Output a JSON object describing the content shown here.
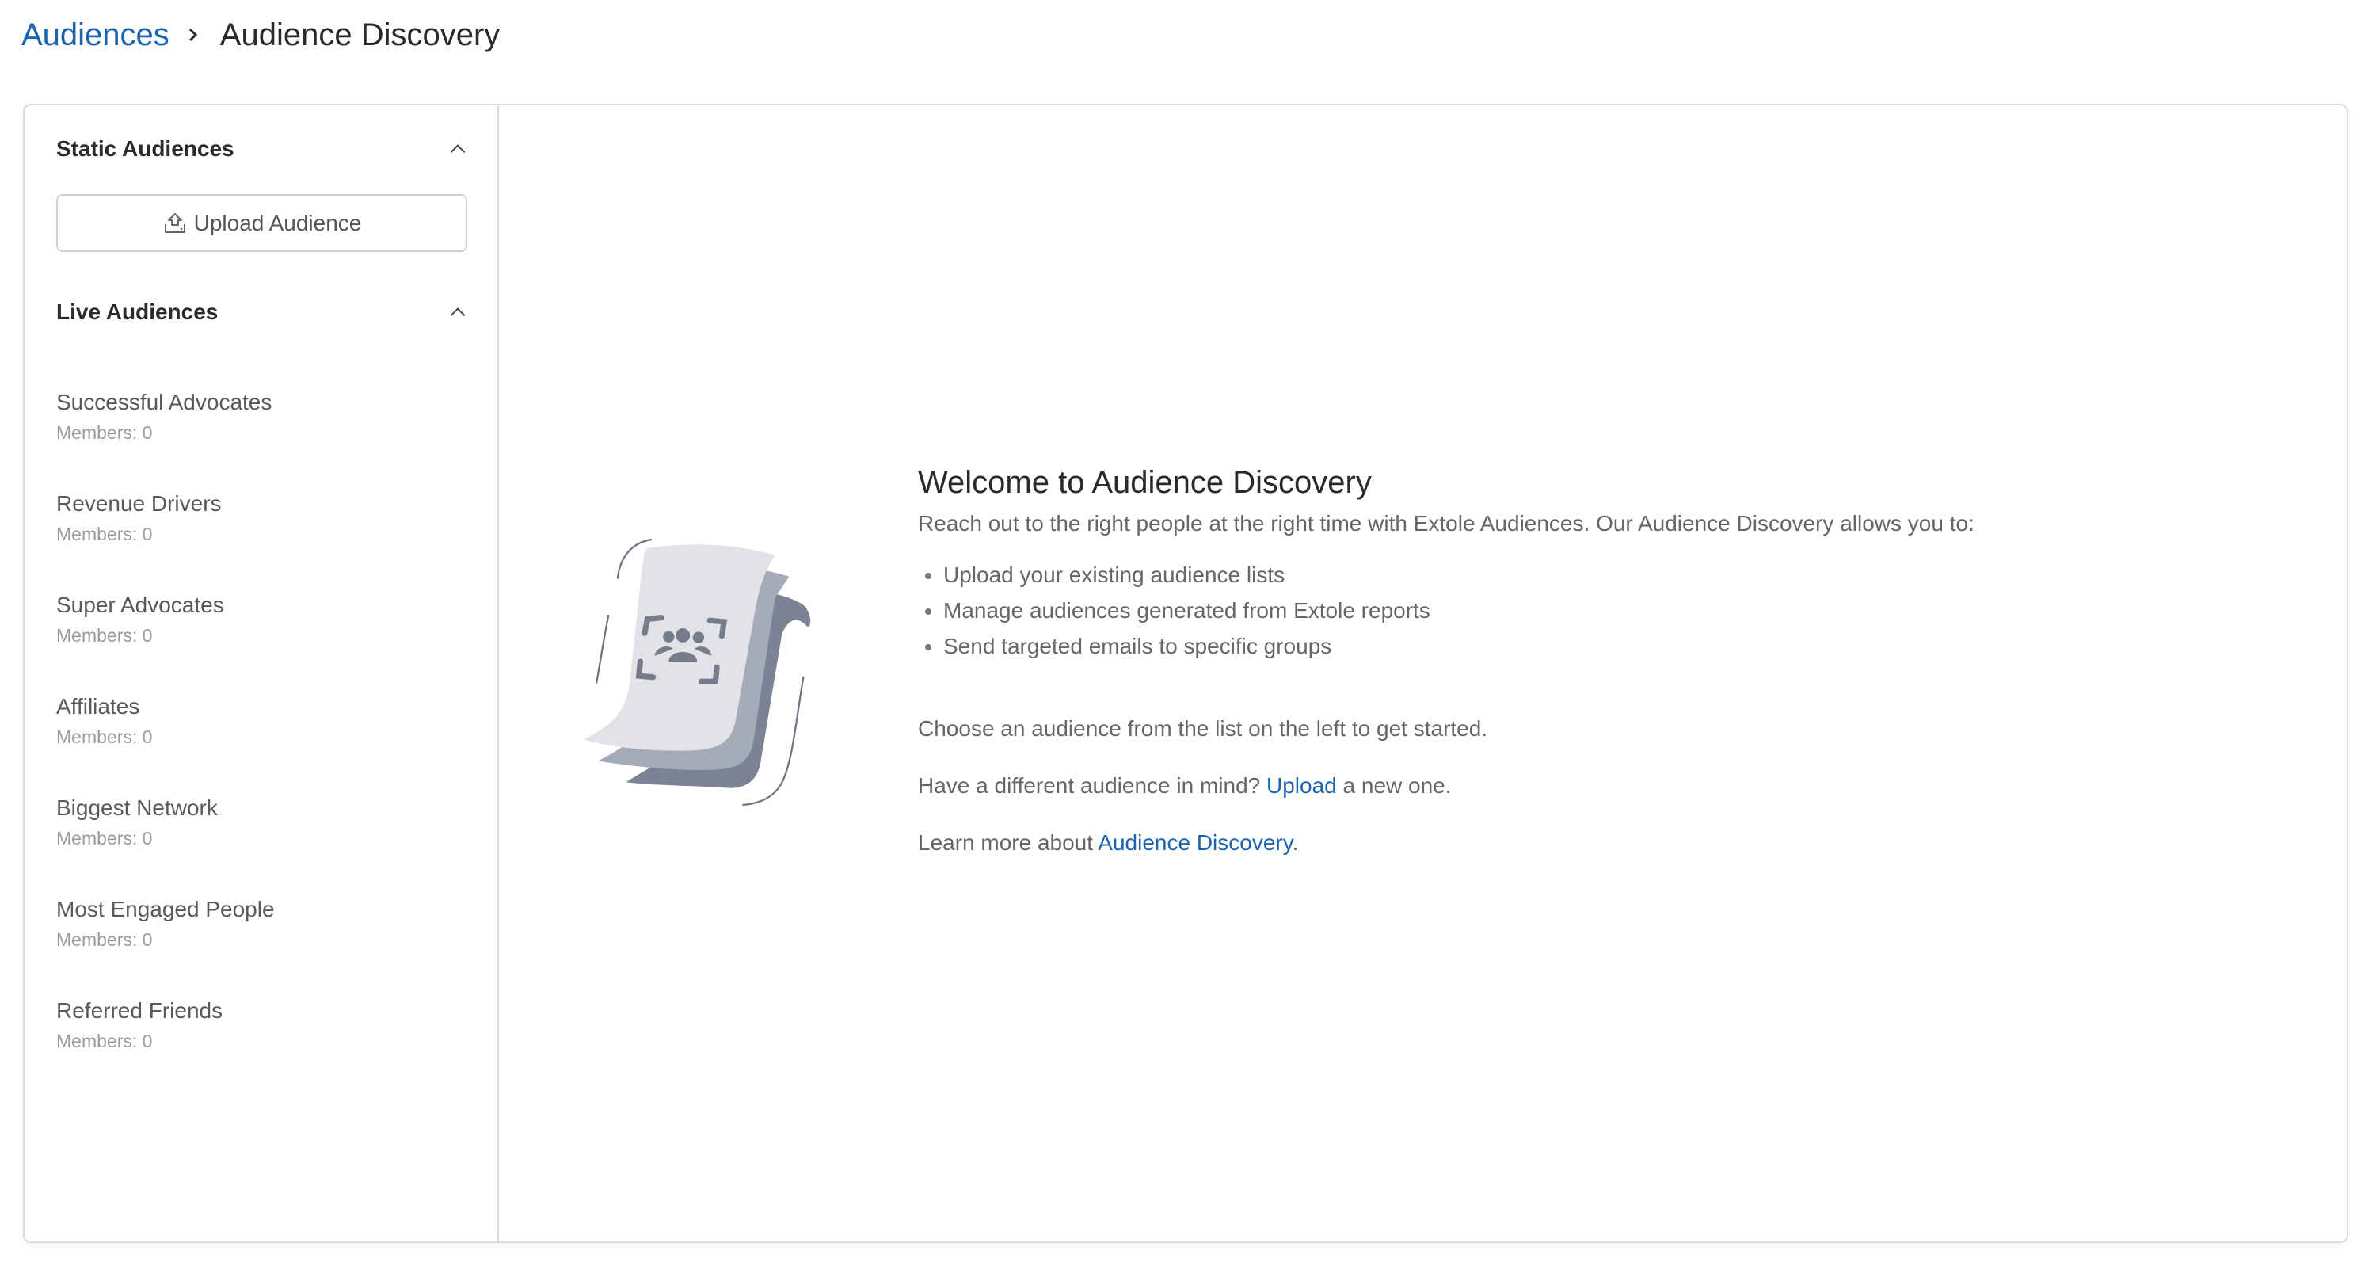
{
  "breadcrumb": {
    "parent": "Audiences",
    "separator_icon": "chevron-right-icon",
    "current": "Audience Discovery"
  },
  "sidebar": {
    "static_section": {
      "title": "Static Audiences",
      "toggle_icon": "chevron-up-icon",
      "upload_button": {
        "label": "Upload Audience",
        "icon": "upload-icon"
      }
    },
    "live_section": {
      "title": "Live Audiences",
      "toggle_icon": "chevron-up-icon",
      "items": [
        {
          "name": "Successful Advocates",
          "members": "Members: 0"
        },
        {
          "name": "Revenue Drivers",
          "members": "Members: 0"
        },
        {
          "name": "Super Advocates",
          "members": "Members: 0"
        },
        {
          "name": "Affiliates",
          "members": "Members: 0"
        },
        {
          "name": "Biggest Network",
          "members": "Members: 0"
        },
        {
          "name": "Most Engaged People",
          "members": "Members: 0"
        },
        {
          "name": "Referred Friends",
          "members": "Members: 0"
        }
      ]
    }
  },
  "main": {
    "illustration": "audience-documents-illustration",
    "title": "Welcome to Audience Discovery",
    "intro": "Reach out to the right people at the right time with Extole Audiences. Our Audience Discovery allows you to:",
    "bullets": [
      "Upload your existing audience lists",
      "Manage audiences generated from Extole reports",
      "Send targeted emails to specific groups"
    ],
    "choose_text": "Choose an audience from the list on the left to get started.",
    "upload_prefix": "Have a different audience in mind? ",
    "upload_link": "Upload",
    "upload_suffix": " a new one.",
    "learn_prefix": "Learn more about ",
    "learn_link": "Audience Discovery",
    "learn_suffix": "."
  },
  "colors": {
    "link": "#1b64b0",
    "border": "#dcdcdc",
    "text_primary": "#2a2a2a",
    "text_secondary": "#666666",
    "text_muted": "#9a9a9a"
  }
}
